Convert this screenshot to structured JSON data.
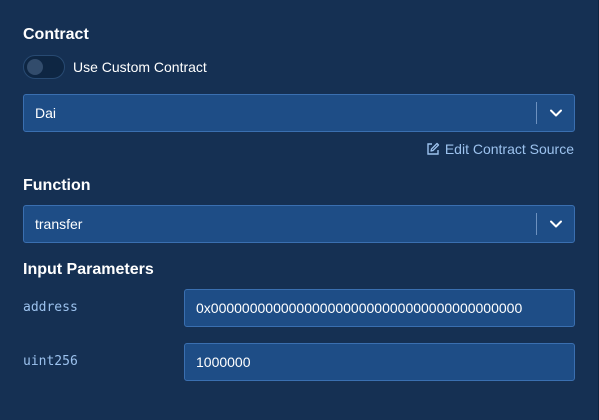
{
  "contract": {
    "title": "Contract",
    "custom_toggle_label": "Use Custom Contract",
    "custom_toggle_on": false,
    "selected": "Dai",
    "edit_source_label": "Edit Contract Source"
  },
  "function": {
    "title": "Function",
    "selected": "transfer"
  },
  "input_parameters": {
    "title": "Input Parameters",
    "params": [
      {
        "label": "address",
        "value": "0x0000000000000000000000000000000000000000"
      },
      {
        "label": "uint256",
        "value": "1000000"
      }
    ]
  },
  "colors": {
    "background": "#153053",
    "field": "#1e4d86",
    "field_border": "#3a6fb0",
    "link": "#9cc2ee"
  },
  "icons": {
    "chevron": "chevron-down-icon",
    "edit": "edit-icon"
  }
}
